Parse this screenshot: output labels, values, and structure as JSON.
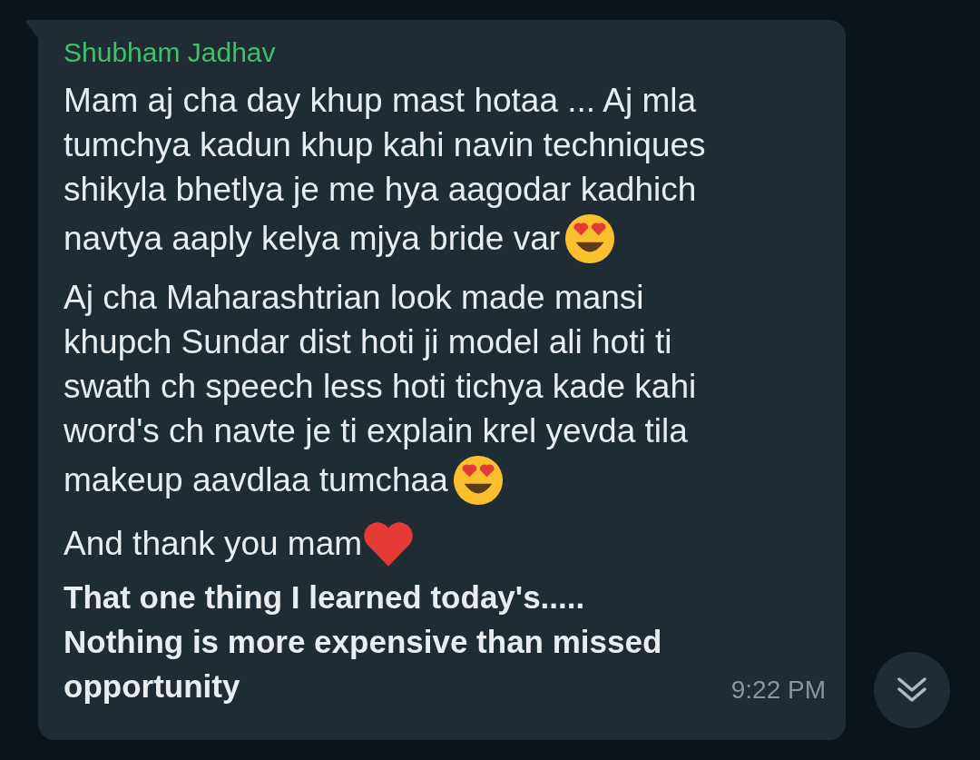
{
  "message": {
    "sender": "Shubham Jadhav",
    "paragraphs": [
      {
        "lines": [
          "Mam aj cha day khup mast hotaa ... Aj mla",
          "tumchya kadun khup kahi navin techniques",
          "shikyla bhetlya je me hya aagodar kadhich",
          "navtya aaply kelya mjya bride var"
        ],
        "bold": false,
        "emoji": {
          "kind": "heart-eyes"
        }
      },
      {
        "lines": [
          "Aj cha Maharashtrian look made mansi",
          "khupch Sundar dist hoti ji model ali hoti ti",
          "swath ch speech less hoti tichya kade kahi",
          "word's ch navte je ti explain krel yevda tila",
          "makeup aavdlaa tumchaa"
        ],
        "bold": false,
        "emoji": {
          "kind": "heart-eyes"
        }
      },
      {
        "lines": [
          "And thank you mam"
        ],
        "bold": false,
        "emoji": {
          "kind": "heart"
        }
      },
      {
        "lines": [
          "That one thing I learned today's.....",
          "Nothing is more expensive than missed",
          "opportunity"
        ],
        "bold": true
      }
    ],
    "time": "9:22 PM"
  }
}
